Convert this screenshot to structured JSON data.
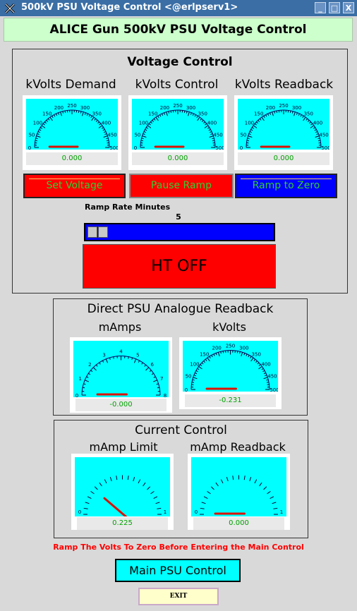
{
  "window": {
    "title": "500kV PSU Voltage Control <@erlpserv1>",
    "buttons": [
      "_",
      "□",
      "X"
    ]
  },
  "header": {
    "title": "ALICE Gun 500kV PSU Voltage Control"
  },
  "voltage_control": {
    "title": "Voltage Control",
    "gauges": [
      {
        "label": "kVolts Demand",
        "readout": "0.000",
        "value": 0
      },
      {
        "label": "kVolts Control",
        "readout": "0.000",
        "value": 0
      },
      {
        "label": "kVolts Readback",
        "readout": "0.000",
        "value": 0
      }
    ],
    "scale_labels": [
      "0",
      "50",
      "100",
      "150",
      "200",
      "250",
      "300",
      "350",
      "400",
      "450",
      "500"
    ],
    "buttons": {
      "set_voltage": "Set Voltage",
      "pause_ramp": "Pause Ramp",
      "ramp_to_zero": "Ramp to Zero"
    },
    "ramp_rate_label": "Ramp Rate Minutes",
    "ramp_rate_value": "5",
    "ht_status": "HT OFF"
  },
  "direct_readback": {
    "title": "Direct PSU Analogue Readback",
    "gauges": [
      {
        "label": "mAmps",
        "readout": "-0.000",
        "value": 0,
        "scale": [
          "0",
          "1",
          "2",
          "3",
          "4",
          "5",
          "6",
          "7",
          "8"
        ]
      },
      {
        "label": "kVolts",
        "readout": "-0.231",
        "value": -0.231,
        "scale": [
          "0",
          "50",
          "100",
          "150",
          "200",
          "250",
          "300",
          "350",
          "400",
          "450",
          "500"
        ]
      }
    ]
  },
  "current_control": {
    "title": "Current Control",
    "gauges": [
      {
        "label": "mAmp Limit",
        "readout": "0.225",
        "value": 0.225,
        "scale": [
          "0",
          "1"
        ]
      },
      {
        "label": "mAmp Readback",
        "readout": "0.000",
        "value": 0,
        "scale": [
          "0",
          "1"
        ]
      }
    ]
  },
  "warning": "Ramp The Volts To Zero Before Entering the Main Control",
  "main_psu_button": "Main PSU Control",
  "exit_button": "EXIT",
  "colors": {
    "cyan": "#00ffff",
    "red": "#ff0000",
    "blue": "#0000ff",
    "green_text": "#33cc33",
    "warning": "#ff0000",
    "exit_bg": "#ffffcc"
  }
}
